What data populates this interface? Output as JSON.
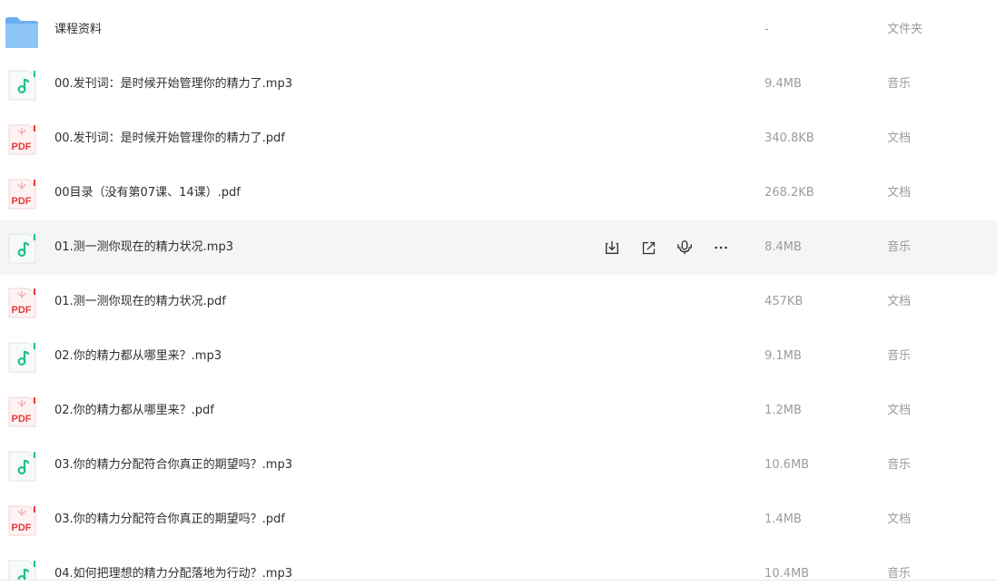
{
  "files": [
    {
      "name": "课程资料",
      "size": "-",
      "type": "文件夹",
      "kind": "folder"
    },
    {
      "name": "00.发刊词：是时候开始管理你的精力了.mp3",
      "size": "9.4MB",
      "type": "音乐",
      "kind": "audio"
    },
    {
      "name": "00.发刊词：是时候开始管理你的精力了.pdf",
      "size": "340.8KB",
      "type": "文档",
      "kind": "pdf"
    },
    {
      "name": "00目录（没有第07课、14课）.pdf",
      "size": "268.2KB",
      "type": "文档",
      "kind": "pdf"
    },
    {
      "name": "01.测一测你现在的精力状况.mp3",
      "size": "8.4MB",
      "type": "音乐",
      "kind": "audio",
      "hovered": true
    },
    {
      "name": "01.测一测你现在的精力状况.pdf",
      "size": "457KB",
      "type": "文档",
      "kind": "pdf"
    },
    {
      "name": "02.你的精力都从哪里来？.mp3",
      "size": "9.1MB",
      "type": "音乐",
      "kind": "audio"
    },
    {
      "name": "02.你的精力都从哪里来？.pdf",
      "size": "1.2MB",
      "type": "文档",
      "kind": "pdf"
    },
    {
      "name": "03.你的精力分配符合你真正的期望吗？.mp3",
      "size": "10.6MB",
      "type": "音乐",
      "kind": "audio"
    },
    {
      "name": "03.你的精力分配符合你真正的期望吗？.pdf",
      "size": "1.4MB",
      "type": "文档",
      "kind": "pdf"
    },
    {
      "name": "04.如何把理想的精力分配落地为行动？.mp3",
      "size": "10.4MB",
      "type": "音乐",
      "kind": "audio"
    }
  ],
  "icons": {
    "folder": "folder-icon",
    "audio": "audio-file-icon",
    "pdf": "pdf-file-icon",
    "download": "download-icon",
    "share": "share-icon",
    "transcribe": "transcribe-icon",
    "more": "more-icon"
  },
  "pdf_label": "PDF",
  "colors": {
    "folder": "#7ab8f5",
    "audio_accent": "#1ec285",
    "pdf_accent": "#e33c3c",
    "hover_bg": "#f5f5f6",
    "text": "#2f2f33",
    "muted": "#9b9ba1"
  }
}
